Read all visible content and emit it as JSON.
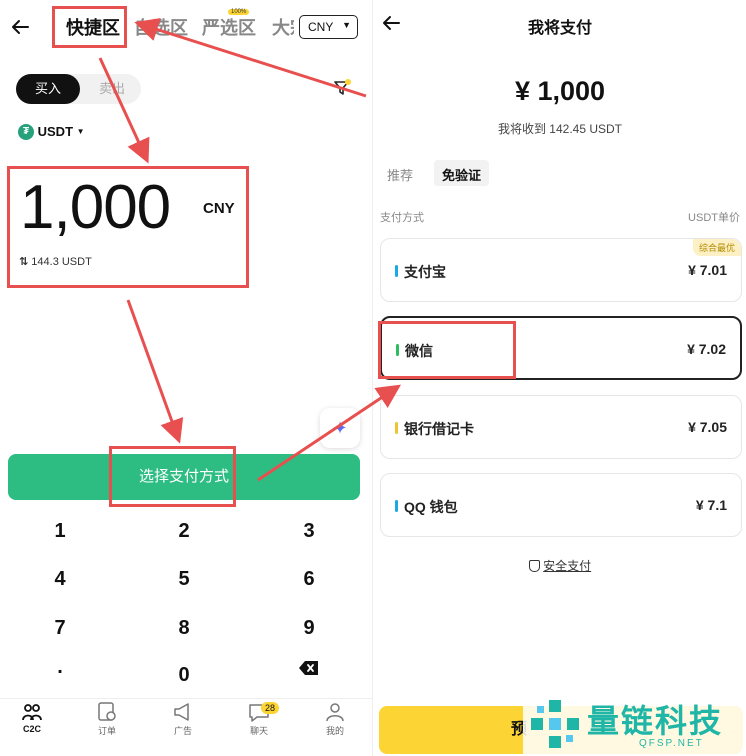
{
  "left": {
    "back_icon": "arrow-left-icon",
    "tabs": [
      {
        "label": "快捷区",
        "active": true
      },
      {
        "label": "自选区",
        "active": false
      },
      {
        "label": "严选区",
        "active": false
      },
      {
        "label": "大宗",
        "active": false
      }
    ],
    "tab_badge": "100%",
    "currency_select": "CNY",
    "buy_label": "买入",
    "sell_label": "卖出",
    "coin": "USDT",
    "amount": "1,000",
    "amount_unit": "CNY",
    "converted": "144.3 USDT",
    "cta": "选择支付方式",
    "keypad": [
      "1",
      "2",
      "3",
      "4",
      "5",
      "6",
      "7",
      "8",
      "9",
      ".",
      "0"
    ],
    "nav": [
      {
        "label": "C2C",
        "icon": "people-icon"
      },
      {
        "label": "订单",
        "icon": "order-icon"
      },
      {
        "label": "广告",
        "icon": "megaphone-icon"
      },
      {
        "label": "聊天",
        "icon": "chat-icon",
        "badge": "28"
      },
      {
        "label": "我的",
        "icon": "user-icon"
      }
    ]
  },
  "right": {
    "title": "我将支付",
    "amount": "¥ 1,000",
    "receive": "我将收到 142.45 USDT",
    "filter_tabs": [
      {
        "label": "推荐",
        "active": false
      },
      {
        "label": "免验证",
        "active": true
      }
    ],
    "col_method": "支付方式",
    "col_price": "USDT单价",
    "best_tag": "综合最优",
    "methods": [
      {
        "name": "支付宝",
        "price": "¥ 7.01",
        "color": "#1aa8e6"
      },
      {
        "name": "微信",
        "price": "¥ 7.02",
        "color": "#2dbd5e"
      },
      {
        "name": "银行借记卡",
        "price": "¥ 7.05",
        "color": "#f2c233"
      },
      {
        "name": "QQ 钱包",
        "price": "¥ 7.1",
        "color": "#1aa8e6"
      }
    ],
    "secure": "安全支付",
    "bottom_button": "预"
  },
  "watermark": {
    "brand": "量链科技",
    "domain": "QFSP.NET"
  },
  "colors": {
    "accent_green": "#2dbd83",
    "annotation_red": "#e8504f",
    "yellow": "#fcd535"
  }
}
